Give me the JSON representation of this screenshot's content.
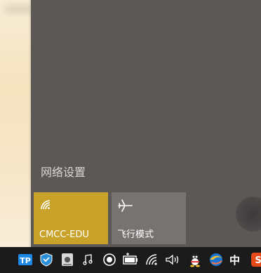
{
  "flyout": {
    "network_settings_label": "网络设置",
    "tiles": [
      {
        "label": "CMCC-EDU",
        "icon": "wifi-icon",
        "state": "on",
        "color": "#c9a22a"
      },
      {
        "label": "飞行模式",
        "icon": "airplane-icon",
        "state": "off",
        "color": "#767371"
      }
    ]
  },
  "taskbar": {
    "ime_label": "中",
    "tray_icons": [
      "tp-link-icon",
      "shield-icon",
      "drive-icon",
      "music-note-icon",
      "record-icon",
      "battery-icon",
      "wifi-icon",
      "volume-icon",
      "qq-penguin-icon",
      "browser-icon",
      "sogou-icon"
    ]
  }
}
